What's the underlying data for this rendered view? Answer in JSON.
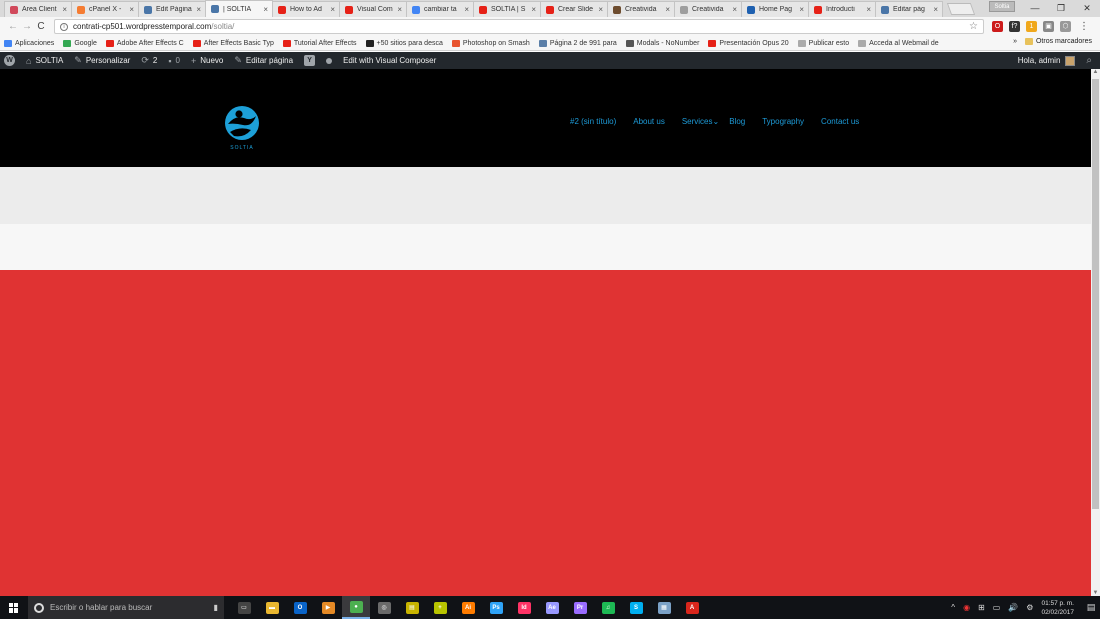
{
  "browser": {
    "tabs": [
      {
        "title": "Area Client",
        "color": "#d1495b"
      },
      {
        "title": "cPanel X -",
        "color": "#f57c32"
      },
      {
        "title": "Edit Página",
        "color": "#4a76a8"
      },
      {
        "title": "| SOLTIA",
        "color": "#4a76a8",
        "active": true
      },
      {
        "title": "How to Ad",
        "color": "#e62117"
      },
      {
        "title": "Visual Com",
        "color": "#e62117"
      },
      {
        "title": "cambiar ta",
        "color": "#4285f4"
      },
      {
        "title": "SOLTIA | S",
        "color": "#e62117"
      },
      {
        "title": "Crear Slide",
        "color": "#e62117"
      },
      {
        "title": "Creativida",
        "color": "#6d4c2e"
      },
      {
        "title": "Creativida",
        "color": "#9e9e9e"
      },
      {
        "title": "Home Pag",
        "color": "#1e60b0"
      },
      {
        "title": "Introducti",
        "color": "#e62117"
      },
      {
        "title": "Editar pág",
        "color": "#4a76a8"
      }
    ],
    "tab_close": "×",
    "profile_label": "Soltia",
    "window_controls": [
      "—",
      "❐",
      "✕"
    ],
    "nav": {
      "back": "←",
      "forward": "→",
      "reload": "C"
    },
    "url_host": "contrati-cp501.wordpresstemporal.com",
    "url_path": "/soltia/",
    "info_glyph": "i",
    "star_glyph": "☆",
    "menu_glyph": "⋮",
    "extensions": [
      {
        "name": "opera-icon",
        "color": "#cc1b1b",
        "glyph": "O"
      },
      {
        "name": "formula-icon",
        "color": "#333333",
        "glyph": "f?"
      },
      {
        "name": "puzzle-icon",
        "color": "#f0a81c",
        "glyph": "1"
      },
      {
        "name": "pocket-icon",
        "color": "#888888",
        "glyph": "▣"
      },
      {
        "name": "shield-icon",
        "color": "#999999",
        "glyph": "⬡"
      }
    ]
  },
  "bookmarks": {
    "items": [
      {
        "label": "Aplicaciones",
        "color": "#4285f4"
      },
      {
        "label": "Google",
        "color": "#34a853"
      },
      {
        "label": "Adobe After Effects C",
        "color": "#e62117"
      },
      {
        "label": "After Effects Basic Typ",
        "color": "#e62117"
      },
      {
        "label": "Tutorial After Effects",
        "color": "#e62117"
      },
      {
        "label": "+50 sitios para desca",
        "color": "#222222"
      },
      {
        "label": "Photoshop on Smash",
        "color": "#e8542f"
      },
      {
        "label": "Página 2 de 991 para",
        "color": "#5b7fa8"
      },
      {
        "label": "Modals - NoNumber",
        "color": "#555555"
      },
      {
        "label": "Presentación Opus 20",
        "color": "#e62117"
      },
      {
        "label": "Publicar esto",
        "color": "#aaaaaa"
      },
      {
        "label": "Acceda al Webmail de",
        "color": "#aaaaaa"
      }
    ],
    "more": "»",
    "other": "Otros marcadores"
  },
  "wp_admin_bar": {
    "site_name": "SOLTIA",
    "customize": "Personalizar",
    "updates_count": "2",
    "comments_count": "0",
    "new_label": "Nuevo",
    "edit_page": "Editar página",
    "vc_label": "Edit with Visual Composer",
    "greeting": "Hola, admin",
    "glyphs": {
      "site": "⌂",
      "customize": "✎",
      "updates": "⟳",
      "comments": "▪",
      "new": "+",
      "edit": "✎",
      "search": "⌕"
    }
  },
  "site": {
    "logo_text": "SOLTIA",
    "nav": [
      "#2 (sin título)",
      "About us",
      "Services",
      "Blog",
      "Typography",
      "Contact us"
    ],
    "services_caret": "⌄",
    "colors": {
      "nav": "#1d9bd8",
      "header_bg": "#000000",
      "hero_red": "#e03333",
      "logo": "#1da0d8"
    }
  },
  "taskbar": {
    "search_placeholder": "Escribir o hablar para buscar",
    "mic": "🎤",
    "apps": [
      {
        "name": "task-view-icon",
        "color": "#444444",
        "glyph": "▭"
      },
      {
        "name": "file-explorer-icon",
        "color": "#e9b730",
        "glyph": "▬"
      },
      {
        "name": "outlook-icon",
        "color": "#0a64c8",
        "glyph": "O"
      },
      {
        "name": "media-player-icon",
        "color": "#e58a26",
        "glyph": "▶"
      },
      {
        "name": "chrome-icon",
        "color": "#4caf50",
        "glyph": "●",
        "active": true
      },
      {
        "name": "browser-icon",
        "color": "#6a6a6a",
        "glyph": "◎"
      },
      {
        "name": "notes-icon",
        "color": "#c8b400",
        "glyph": "▤"
      },
      {
        "name": "plus-app-icon",
        "color": "#b8c400",
        "glyph": "+"
      },
      {
        "name": "illustrator-icon",
        "color": "#ff7c00",
        "glyph": "Ai"
      },
      {
        "name": "photoshop-icon",
        "color": "#2fa3f7",
        "glyph": "Ps"
      },
      {
        "name": "indesign-icon",
        "color": "#ff3366",
        "glyph": "Id"
      },
      {
        "name": "after-effects-icon",
        "color": "#9999ff",
        "glyph": "Ae"
      },
      {
        "name": "premiere-icon",
        "color": "#9a6cff",
        "glyph": "Pr"
      },
      {
        "name": "spotify-icon",
        "color": "#1db954",
        "glyph": "♫"
      },
      {
        "name": "skype-icon",
        "color": "#00aff0",
        "glyph": "S"
      },
      {
        "name": "scanner-icon",
        "color": "#7ba1c6",
        "glyph": "▦"
      },
      {
        "name": "acrobat-icon",
        "color": "#d9261c",
        "glyph": "A"
      }
    ],
    "tray_glyphs": [
      "^",
      "◉",
      "⊞",
      "▭",
      "🔊",
      "⚙"
    ],
    "time": "01:57 p. m.",
    "date": "02/02/2017",
    "notif_glyph": "▤"
  }
}
